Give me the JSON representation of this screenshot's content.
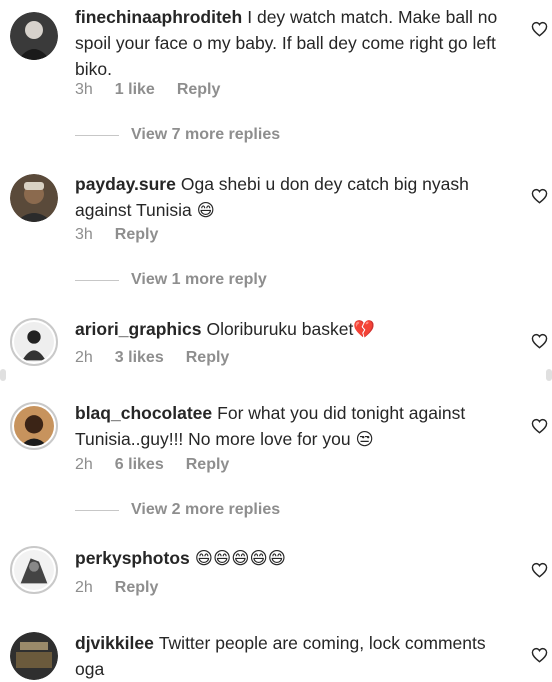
{
  "comments": [
    {
      "username": "finechinaaphroditeh",
      "text": "I dey watch match. Make ball no spoil your face o my baby. If ball dey come right go left biko.",
      "time": "3h",
      "likes": "1 like",
      "reply": "Reply",
      "view_more": "View 7 more replies"
    },
    {
      "username": "payday.sure",
      "text": "Oga shebi u don dey catch big nyash against Tunisia 😄",
      "time": "3h",
      "likes": "",
      "reply": "Reply",
      "view_more": "View 1 more reply"
    },
    {
      "username": "ariori_graphics",
      "text": "Oloriburuku basket💔",
      "time": "2h",
      "likes": "3 likes",
      "reply": "Reply",
      "view_more": ""
    },
    {
      "username": "blaq_chocolatee",
      "text": "For what you did tonight against Tunisia..guy!!! No more love for you 😒",
      "time": "2h",
      "likes": "6 likes",
      "reply": "Reply",
      "view_more": "View 2 more replies"
    },
    {
      "username": "perkysphotos",
      "text": "😄😄😄😄😄",
      "time": "2h",
      "likes": "",
      "reply": "Reply",
      "view_more": ""
    },
    {
      "username": "djvikkilee",
      "text": "Twitter people are coming, lock comments oga",
      "time": "",
      "likes": "",
      "reply": "",
      "view_more": ""
    }
  ],
  "icons": {
    "like": "heart-icon",
    "avatar": "avatar"
  },
  "colors": {
    "text": "#262626",
    "meta": "#8e8e8e",
    "divider": "#c7c7c7"
  }
}
